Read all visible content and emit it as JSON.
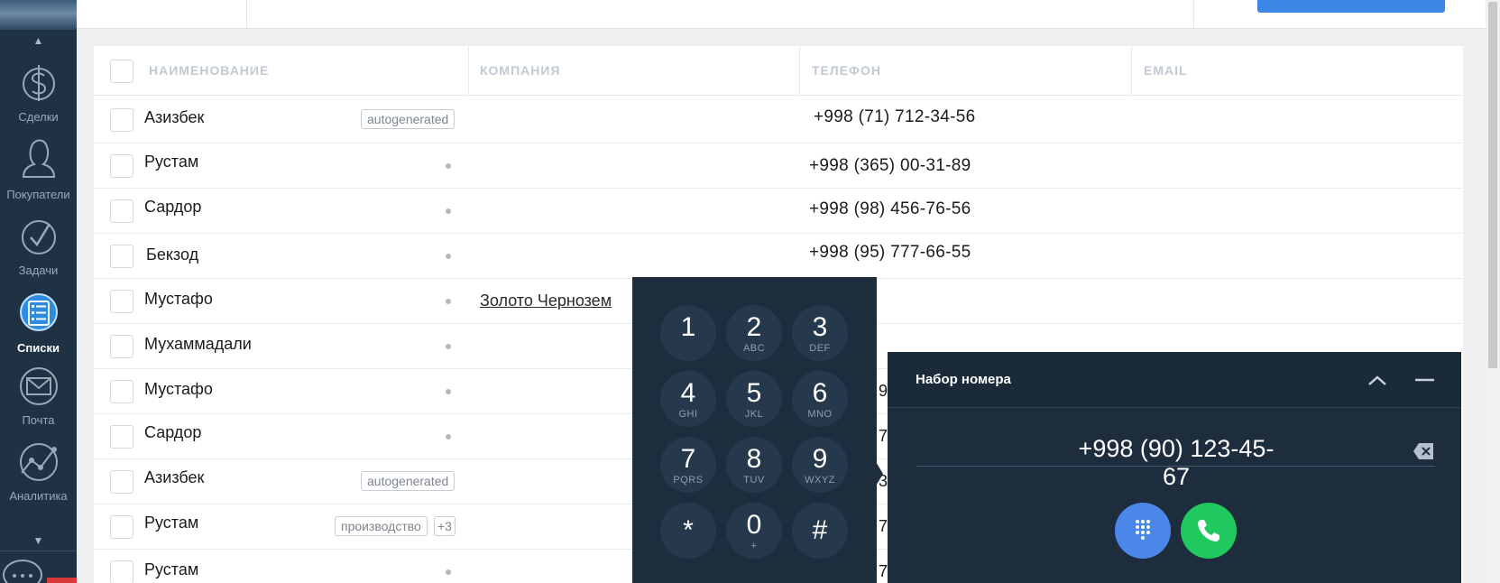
{
  "sidebar": {
    "items": [
      {
        "label": "Сделки",
        "icon": "dollar-icon"
      },
      {
        "label": "Покупатели",
        "icon": "user-icon"
      },
      {
        "label": "Задачи",
        "icon": "check-circle-icon"
      },
      {
        "label": "Списки",
        "icon": "list-icon",
        "active": true
      },
      {
        "label": "Почта",
        "icon": "mail-icon"
      },
      {
        "label": "Аналитика",
        "icon": "analytics-icon"
      }
    ],
    "scroll_up": "▲",
    "scroll_down": "▼"
  },
  "table": {
    "columns": [
      "НАИМЕНОВАНИЕ",
      "КОМПАНИЯ",
      "ТЕЛЕФОН",
      "EMAIL"
    ],
    "rows": [
      {
        "name": "Азизбек",
        "tags": [
          "autogenerated"
        ],
        "company": "",
        "phone": "+998 (71) 712-34-56"
      },
      {
        "name": "Рустам",
        "tags": [],
        "company": "",
        "phone": "+998 (365) 00-31-89"
      },
      {
        "name": "Сардор",
        "tags": [],
        "company": "",
        "phone": "+998 (98) 456-76-56"
      },
      {
        "name": "Бекзод",
        "tags": [],
        "company": "",
        "phone": "+998 (95) 777-66-55"
      },
      {
        "name": "Мустафо",
        "tags": [],
        "company": "Золото Чернозем",
        "phone": ""
      },
      {
        "name": "Мухаммадали",
        "tags": [],
        "company": "",
        "phone": ""
      },
      {
        "name": "Мустафо",
        "tags": [],
        "company": "",
        "phone": "9"
      },
      {
        "name": "Сардор",
        "tags": [],
        "company": "",
        "phone": "7"
      },
      {
        "name": "Азизбек",
        "tags": [
          "autogenerated"
        ],
        "company": "",
        "phone": "3"
      },
      {
        "name": "Рустам",
        "tags": [
          "производство",
          "+3"
        ],
        "company": "",
        "phone": "7"
      },
      {
        "name": "Рустам",
        "tags": [],
        "company": "",
        "phone": "7"
      }
    ]
  },
  "keypad": {
    "keys": [
      {
        "digit": "1",
        "letters": ""
      },
      {
        "digit": "2",
        "letters": "ABC"
      },
      {
        "digit": "3",
        "letters": "DEF"
      },
      {
        "digit": "4",
        "letters": "GHI"
      },
      {
        "digit": "5",
        "letters": "JKL"
      },
      {
        "digit": "6",
        "letters": "MNO"
      },
      {
        "digit": "7",
        "letters": "PQRS"
      },
      {
        "digit": "8",
        "letters": "TUV"
      },
      {
        "digit": "9",
        "letters": "WXYZ"
      },
      {
        "digit": "*",
        "letters": ""
      },
      {
        "digit": "0",
        "letters": "+"
      },
      {
        "digit": "#",
        "letters": ""
      }
    ]
  },
  "dialer": {
    "title": "Набор номера",
    "number": "+998 (90) 123-45-67",
    "icons": [
      "chevron-up-icon",
      "minimize-icon",
      "backspace-icon",
      "keypad-grid-icon",
      "phone-icon"
    ]
  },
  "colors": {
    "sidebar_bg": "#1f3244",
    "dialer_bg": "#1d2d3d",
    "primary_blue": "#3c86e8",
    "call_green": "#1fc95f",
    "keypad_blue": "#4a87e8"
  }
}
